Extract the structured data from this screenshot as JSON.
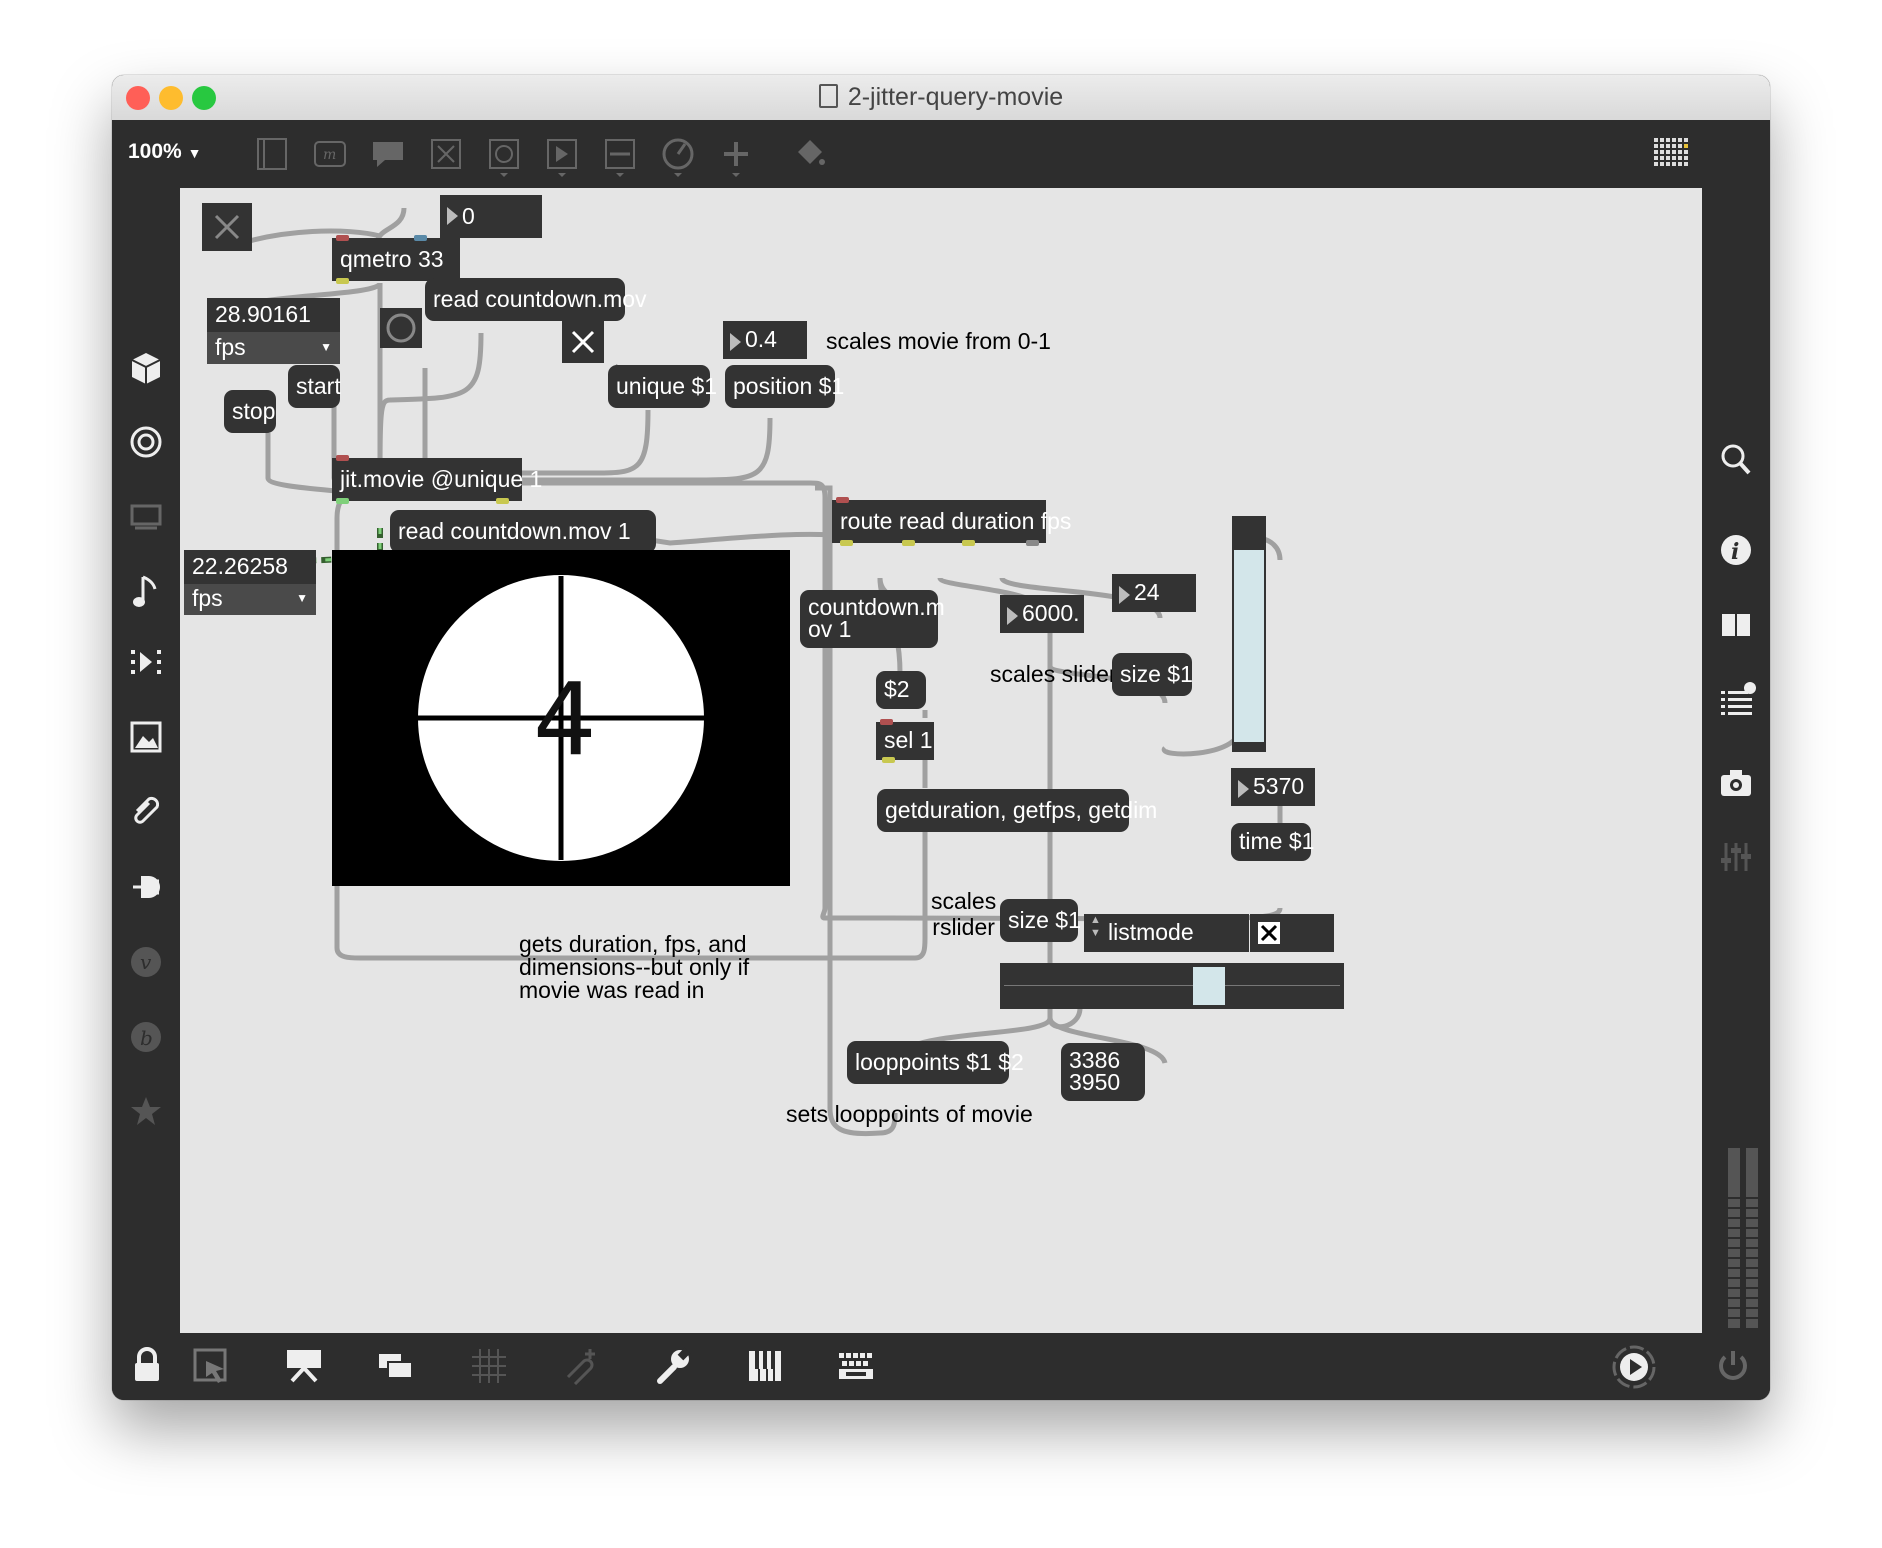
{
  "window": {
    "title": "2-jitter-query-movie",
    "traffic_lights": [
      "#ff5f57",
      "#febc2e",
      "#28c840"
    ]
  },
  "toolbar": {
    "zoom": "100%",
    "icons": [
      "new-object-icon",
      "message-icon",
      "comment-icon",
      "toggle-icon",
      "button-icon",
      "number-icon",
      "slider-icon",
      "dial-icon",
      "add-icon",
      "paint-bucket-icon",
      "grid-presentation-icon"
    ]
  },
  "left_sidebar": {
    "icons": [
      "cube-icon",
      "target-icon",
      "display-icon",
      "music-note-icon",
      "sequence-icon",
      "image-icon",
      "paperclip-icon",
      "plug-icon",
      "vst-icon",
      "beap-icon",
      "star-icon"
    ]
  },
  "right_sidebar": {
    "icons": [
      "search-icon",
      "info-icon",
      "book-icon",
      "list-icon",
      "camera-icon",
      "mixer-icon"
    ]
  },
  "bottom_bar": {
    "icons": [
      "lock-icon",
      "select-icon",
      "presentation-icon",
      "windows-icon",
      "grid-icon",
      "snap-icon",
      "wrench-icon",
      "piano-icon",
      "keyboard-icon",
      "play-icon",
      "power-icon"
    ]
  },
  "patch": {
    "qmetro": "qmetro 33",
    "metro_number": "0",
    "read_msg": "read countdown.mov",
    "fps_top_value": "28.90161",
    "fps_top_label": "fps",
    "start_msg": "start",
    "stop_msg": "stop",
    "unique_msg": "unique $1",
    "position_number": "0.4",
    "position_msg": "position $1",
    "position_comment": "scales movie from 0-1",
    "jit_movie": "jit.movie @unique 1",
    "read_result_msg": "read countdown.mov 1",
    "fps_left_value": "22.26258",
    "fps_left_label": "fps",
    "route": "route read duration fps",
    "countdown_msg": "countdown.m\nov 1",
    "dollar2_msg": "$2",
    "sel": "sel 1",
    "getdur_msg": "getduration, getfps, getdim",
    "duration_number": "6000.",
    "fps_number": "24",
    "scales_slider_comment": "scales slider",
    "size_msg_1": "size $1",
    "time_number": "5370",
    "time_msg": "time $1",
    "scales_rslider_comment": "scales\nrslider",
    "size_msg_2": "size $1",
    "listmode_label": "listmode",
    "getdur_comment": "gets duration, fps, and\ndimensions--but only if\nmovie was read in",
    "looppoints_msg": "looppoints $1 $2",
    "looppoints_values": "3386\n3950",
    "looppoints_comment": "sets looppoints of movie",
    "movie_frame_text": "4",
    "slider_value": 0.89,
    "rslider_range": [
      3386,
      3950
    ],
    "rslider_max": 6000,
    "colors": {
      "canvas": "#e5e5e5",
      "object": "#333333",
      "patchcord": "#a8a8a8",
      "signal_cord": "#66cc66",
      "slider_fill": "#d3e6ea"
    }
  }
}
